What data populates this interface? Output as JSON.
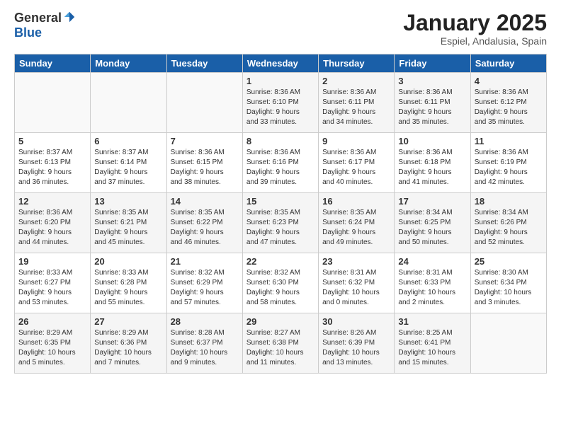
{
  "logo": {
    "general": "General",
    "blue": "Blue"
  },
  "title": "January 2025",
  "location": "Espiel, Andalusia, Spain",
  "days_header": [
    "Sunday",
    "Monday",
    "Tuesday",
    "Wednesday",
    "Thursday",
    "Friday",
    "Saturday"
  ],
  "weeks": [
    [
      {
        "day": "",
        "info": ""
      },
      {
        "day": "",
        "info": ""
      },
      {
        "day": "",
        "info": ""
      },
      {
        "day": "1",
        "info": "Sunrise: 8:36 AM\nSunset: 6:10 PM\nDaylight: 9 hours\nand 33 minutes."
      },
      {
        "day": "2",
        "info": "Sunrise: 8:36 AM\nSunset: 6:11 PM\nDaylight: 9 hours\nand 34 minutes."
      },
      {
        "day": "3",
        "info": "Sunrise: 8:36 AM\nSunset: 6:11 PM\nDaylight: 9 hours\nand 35 minutes."
      },
      {
        "day": "4",
        "info": "Sunrise: 8:36 AM\nSunset: 6:12 PM\nDaylight: 9 hours\nand 35 minutes."
      }
    ],
    [
      {
        "day": "5",
        "info": "Sunrise: 8:37 AM\nSunset: 6:13 PM\nDaylight: 9 hours\nand 36 minutes."
      },
      {
        "day": "6",
        "info": "Sunrise: 8:37 AM\nSunset: 6:14 PM\nDaylight: 9 hours\nand 37 minutes."
      },
      {
        "day": "7",
        "info": "Sunrise: 8:36 AM\nSunset: 6:15 PM\nDaylight: 9 hours\nand 38 minutes."
      },
      {
        "day": "8",
        "info": "Sunrise: 8:36 AM\nSunset: 6:16 PM\nDaylight: 9 hours\nand 39 minutes."
      },
      {
        "day": "9",
        "info": "Sunrise: 8:36 AM\nSunset: 6:17 PM\nDaylight: 9 hours\nand 40 minutes."
      },
      {
        "day": "10",
        "info": "Sunrise: 8:36 AM\nSunset: 6:18 PM\nDaylight: 9 hours\nand 41 minutes."
      },
      {
        "day": "11",
        "info": "Sunrise: 8:36 AM\nSunset: 6:19 PM\nDaylight: 9 hours\nand 42 minutes."
      }
    ],
    [
      {
        "day": "12",
        "info": "Sunrise: 8:36 AM\nSunset: 6:20 PM\nDaylight: 9 hours\nand 44 minutes."
      },
      {
        "day": "13",
        "info": "Sunrise: 8:35 AM\nSunset: 6:21 PM\nDaylight: 9 hours\nand 45 minutes."
      },
      {
        "day": "14",
        "info": "Sunrise: 8:35 AM\nSunset: 6:22 PM\nDaylight: 9 hours\nand 46 minutes."
      },
      {
        "day": "15",
        "info": "Sunrise: 8:35 AM\nSunset: 6:23 PM\nDaylight: 9 hours\nand 47 minutes."
      },
      {
        "day": "16",
        "info": "Sunrise: 8:35 AM\nSunset: 6:24 PM\nDaylight: 9 hours\nand 49 minutes."
      },
      {
        "day": "17",
        "info": "Sunrise: 8:34 AM\nSunset: 6:25 PM\nDaylight: 9 hours\nand 50 minutes."
      },
      {
        "day": "18",
        "info": "Sunrise: 8:34 AM\nSunset: 6:26 PM\nDaylight: 9 hours\nand 52 minutes."
      }
    ],
    [
      {
        "day": "19",
        "info": "Sunrise: 8:33 AM\nSunset: 6:27 PM\nDaylight: 9 hours\nand 53 minutes."
      },
      {
        "day": "20",
        "info": "Sunrise: 8:33 AM\nSunset: 6:28 PM\nDaylight: 9 hours\nand 55 minutes."
      },
      {
        "day": "21",
        "info": "Sunrise: 8:32 AM\nSunset: 6:29 PM\nDaylight: 9 hours\nand 57 minutes."
      },
      {
        "day": "22",
        "info": "Sunrise: 8:32 AM\nSunset: 6:30 PM\nDaylight: 9 hours\nand 58 minutes."
      },
      {
        "day": "23",
        "info": "Sunrise: 8:31 AM\nSunset: 6:32 PM\nDaylight: 10 hours\nand 0 minutes."
      },
      {
        "day": "24",
        "info": "Sunrise: 8:31 AM\nSunset: 6:33 PM\nDaylight: 10 hours\nand 2 minutes."
      },
      {
        "day": "25",
        "info": "Sunrise: 8:30 AM\nSunset: 6:34 PM\nDaylight: 10 hours\nand 3 minutes."
      }
    ],
    [
      {
        "day": "26",
        "info": "Sunrise: 8:29 AM\nSunset: 6:35 PM\nDaylight: 10 hours\nand 5 minutes."
      },
      {
        "day": "27",
        "info": "Sunrise: 8:29 AM\nSunset: 6:36 PM\nDaylight: 10 hours\nand 7 minutes."
      },
      {
        "day": "28",
        "info": "Sunrise: 8:28 AM\nSunset: 6:37 PM\nDaylight: 10 hours\nand 9 minutes."
      },
      {
        "day": "29",
        "info": "Sunrise: 8:27 AM\nSunset: 6:38 PM\nDaylight: 10 hours\nand 11 minutes."
      },
      {
        "day": "30",
        "info": "Sunrise: 8:26 AM\nSunset: 6:39 PM\nDaylight: 10 hours\nand 13 minutes."
      },
      {
        "day": "31",
        "info": "Sunrise: 8:25 AM\nSunset: 6:41 PM\nDaylight: 10 hours\nand 15 minutes."
      },
      {
        "day": "",
        "info": ""
      }
    ]
  ]
}
